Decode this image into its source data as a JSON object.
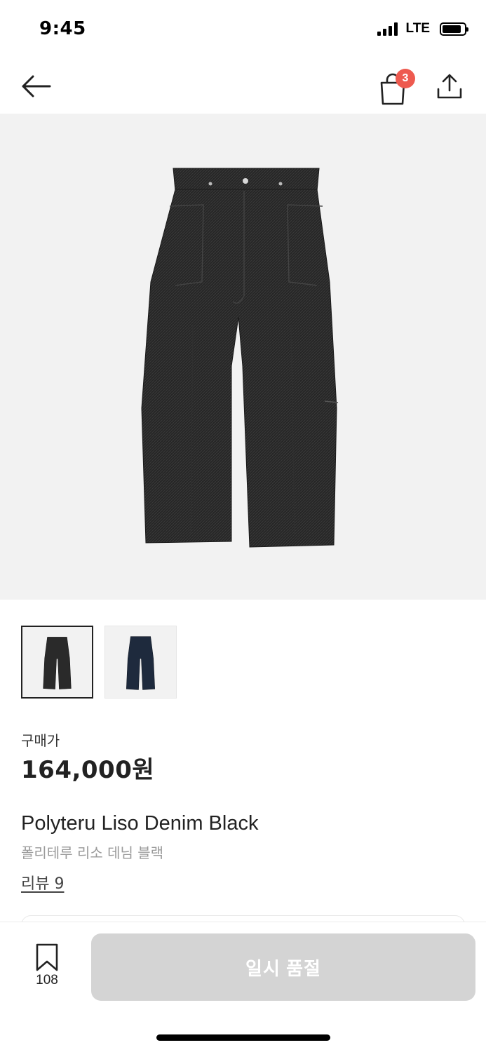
{
  "status_bar": {
    "time": "9:45",
    "network": "LTE"
  },
  "nav": {
    "cart_count": "3",
    "icons": [
      "arrow-left-icon",
      "shopping-bag-icon",
      "share-icon"
    ]
  },
  "product": {
    "price_label": "구매가",
    "price": "164,000원",
    "name": "Polyteru Liso Denim Black",
    "name_kr": "폴리테루 리소 데님 블랙",
    "review_text": "리뷰 9",
    "thumbnails": [
      {
        "color": "#2a2a2a",
        "selected": true
      },
      {
        "color": "#1e2a3d",
        "selected": false
      }
    ]
  },
  "bottom": {
    "bookmark_count": "108",
    "action_label": "일시 품절"
  },
  "colors": {
    "badge": "#ee5a4f",
    "disabled_button": "#d4d4d4",
    "image_bg": "#f2f2f2"
  }
}
